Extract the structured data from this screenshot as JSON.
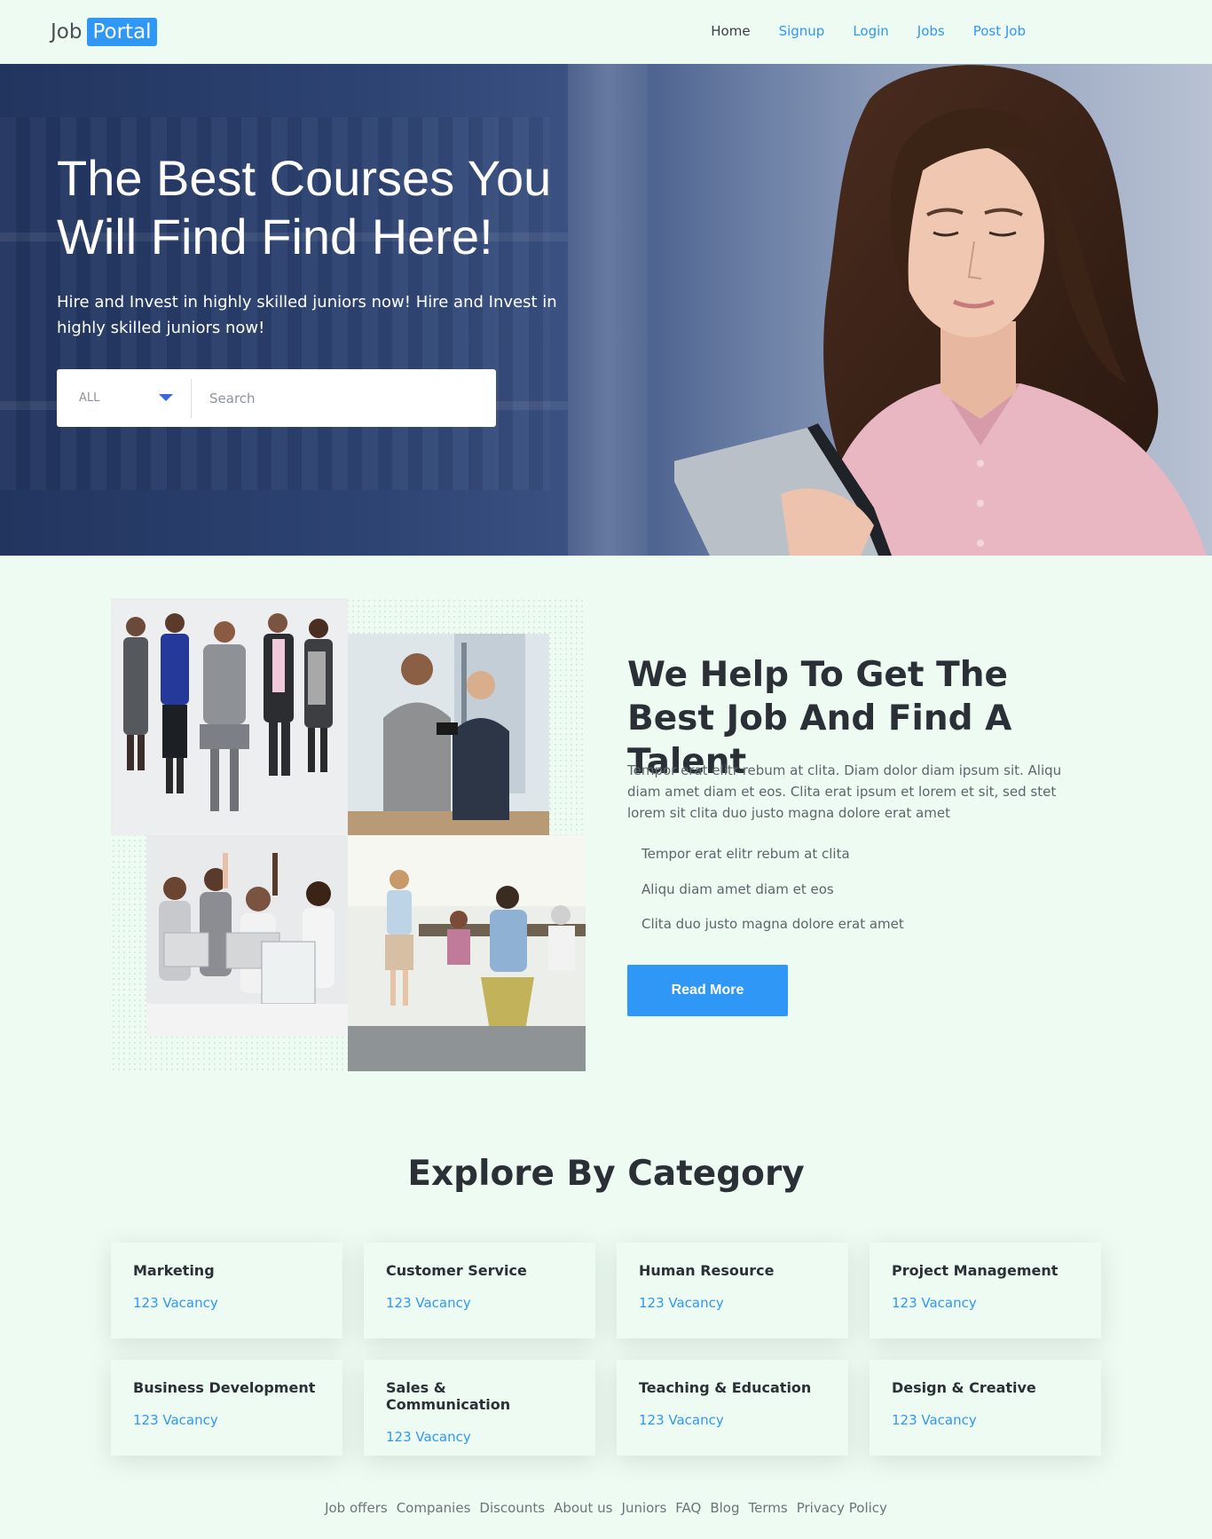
{
  "nav": {
    "brand_part1": "Job",
    "brand_part2": "Portal",
    "links": [
      "Home",
      "Signup",
      "Login",
      "Jobs",
      "Post Job"
    ]
  },
  "hero": {
    "title": "The Best Courses You Will Find Find Here!",
    "subtitle": "Hire and Invest in highly skilled juniors now! Hire and Invest in highly skilled juniors now!",
    "search": {
      "select_value": "ALL",
      "placeholder": "Search"
    }
  },
  "about": {
    "title": "We Help To Get The Best Job And Find A Talent",
    "text": "Tempor erat elitr rebum at clita. Diam dolor diam ipsum sit. Aliqu diam amet diam et eos. Clita erat ipsum et lorem et sit, sed stet lorem sit clita duo justo magna dolore erat amet",
    "list": [
      "Tempor erat elitr rebum at clita",
      "Aliqu diam amet diam et eos",
      "Clita duo justo magna dolore erat amet"
    ],
    "button": "Read More"
  },
  "categories": {
    "title": "Explore By Category",
    "items": [
      {
        "name": "Marketing",
        "count": "123 Vacancy"
      },
      {
        "name": "Customer Service",
        "count": "123 Vacancy"
      },
      {
        "name": "Human Resource",
        "count": "123 Vacancy"
      },
      {
        "name": "Project Management",
        "count": "123 Vacancy"
      },
      {
        "name": "Business Development",
        "count": "123 Vacancy"
      },
      {
        "name": "Sales & Communication",
        "count": "123 Vacancy"
      },
      {
        "name": "Teaching & Education",
        "count": "123 Vacancy"
      },
      {
        "name": "Design & Creative",
        "count": "123 Vacancy"
      }
    ]
  },
  "footer": {
    "links": [
      "Job offers",
      "Companies",
      "Discounts",
      "About us",
      "Juniors",
      "FAQ",
      "Blog",
      "Terms",
      "Privacy Policy"
    ]
  },
  "colors": {
    "accent": "#2f97f5",
    "background": "#eefbf2",
    "heading": "#2b3037"
  }
}
